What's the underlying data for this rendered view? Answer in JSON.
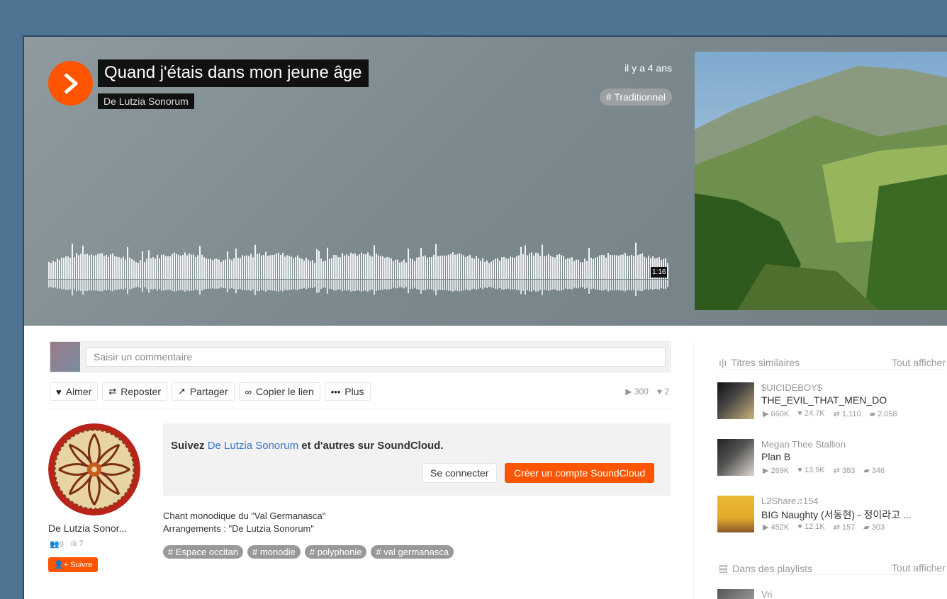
{
  "hero": {
    "title": "Quand j'étais dans mon jeune âge",
    "artist": "De Lutzia Sonorum",
    "date": "il y a 4 ans",
    "tag": "# Traditionnel",
    "duration": "1:16",
    "colors": {
      "accent": "#ff5500"
    }
  },
  "comment": {
    "placeholder": "Saisir un commentaire"
  },
  "actions": {
    "like": "Aimer",
    "repost": "Reposter",
    "share": "Partager",
    "copy_link": "Copier le lien",
    "more": "Plus",
    "plays": "300",
    "likes": "2"
  },
  "artist": {
    "name": "De Lutzia Sonor...",
    "followers": "9",
    "tracks": "7",
    "follow": "Suivre"
  },
  "signup": {
    "prefix": "Suivez ",
    "artist_link": "De Lutzia Sonorum",
    "suffix": " et d'autres sur SoundCloud.",
    "login": "Se connecter",
    "create": "Créer un compte SoundCloud"
  },
  "description": {
    "line1": "Chant monodique du \"Val Germanasca\"",
    "line2": "Arrangements : \"De Lutzia Sonorum\""
  },
  "tags": [
    "# Espace occitan",
    "# monodie",
    "# polyphonie",
    "# val germanasca"
  ],
  "sidebar": {
    "similar": {
      "heading": "Titres similaires",
      "view_all": "Tout afficher",
      "tracks": [
        {
          "user": "$UICIDEBOY$",
          "title": "THE_EVIL_THAT_MEN_DO",
          "plays": "660K",
          "likes": "24,7K",
          "reposts": "1.110",
          "comments": "2.058"
        },
        {
          "user": "Megan Thee Stallion",
          "title": "Plan B",
          "plays": "269K",
          "likes": "13,9K",
          "reposts": "383",
          "comments": "346"
        },
        {
          "user": "L2Share♫154",
          "title": "BIG Naughty (서동현) - 정이라고 ...",
          "plays": "452K",
          "likes": "12,1K",
          "reposts": "157",
          "comments": "303"
        }
      ]
    },
    "playlists": {
      "heading": "Dans des playlists",
      "view_all": "Tout afficher",
      "first_user": "Vri"
    }
  }
}
